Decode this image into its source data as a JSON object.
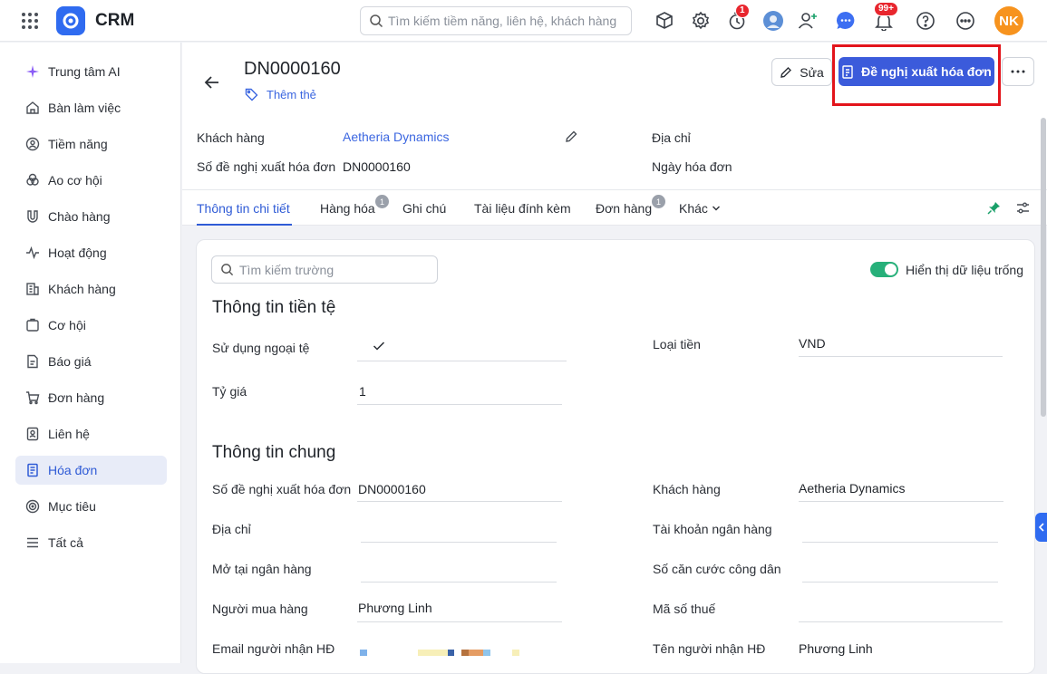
{
  "app": {
    "name": "CRM",
    "search_placeholder": "Tìm kiếm tiềm năng, liên hệ, khách hàng",
    "user_initials": "NK",
    "reminder_count": "1",
    "notification_count": "99+"
  },
  "sidebar": {
    "items": [
      {
        "label": "Trung tâm AI",
        "icon": "ai-sparkle-icon"
      },
      {
        "label": "Bàn làm việc",
        "icon": "home-icon"
      },
      {
        "label": "Tiềm năng",
        "icon": "lead-icon"
      },
      {
        "label": "Ao cơ hội",
        "icon": "pool-icon"
      },
      {
        "label": "Chào hàng",
        "icon": "magnet-icon"
      },
      {
        "label": "Hoạt động",
        "icon": "activity-icon"
      },
      {
        "label": "Khách hàng",
        "icon": "building-icon"
      },
      {
        "label": "Cơ hội",
        "icon": "opportunity-icon"
      },
      {
        "label": "Báo giá",
        "icon": "quote-icon"
      },
      {
        "label": "Đơn hàng",
        "icon": "cart-icon"
      },
      {
        "label": "Liên hệ",
        "icon": "contact-icon"
      },
      {
        "label": "Hóa đơn",
        "icon": "invoice-icon"
      },
      {
        "label": "Mục tiêu",
        "icon": "target-icon"
      },
      {
        "label": "Tất cả",
        "icon": "list-icon"
      }
    ],
    "active": "Hóa đơn"
  },
  "record": {
    "id": "DN0000160",
    "add_tag": "Thêm thẻ",
    "edit_label": "Sửa",
    "primary_action": "Đề nghị xuất hóa đơn",
    "header_fields": {
      "customer_label": "Khách hàng",
      "customer_value": "Aetheria Dynamics",
      "request_no_label": "Số đề nghị xuất hóa đơn",
      "request_no_value": "DN0000160",
      "address_label": "Địa chỉ",
      "invoice_date_label": "Ngày hóa đơn"
    }
  },
  "tabs": [
    {
      "label": "Thông tin chi tiết"
    },
    {
      "label": "Hàng hóa",
      "badge": "1"
    },
    {
      "label": "Ghi chú"
    },
    {
      "label": "Tài liệu đính kèm"
    },
    {
      "label": "Đơn hàng",
      "badge": "1"
    },
    {
      "label": "Khác"
    }
  ],
  "detail": {
    "field_search_placeholder": "Tìm kiếm trường",
    "show_empty_label": "Hiển thị dữ liệu trống",
    "currency_section": {
      "title": "Thông tin tiền tệ",
      "use_foreign_label": "Sử dụng ngoại tệ",
      "currency_label": "Loại tiền",
      "currency_value": "VND",
      "rate_label": "Tỷ giá",
      "rate_value": "1"
    },
    "general_section": {
      "title": "Thông tin chung",
      "request_no_label": "Số đề nghị xuất hóa đơn",
      "request_no_value": "DN0000160",
      "customer_label": "Khách hàng",
      "customer_value": "Aetheria Dynamics",
      "address_label": "Địa chỉ",
      "bank_account_label": "Tài khoản ngân hàng",
      "bank_open_label": "Mở tại ngân hàng",
      "citizen_id_label": "Số căn cước công dân",
      "buyer_label": "Người mua hàng",
      "buyer_value": "Phương Linh",
      "tax_code_label": "Mã số thuế",
      "email_label": "Email người nhận HĐ",
      "receiver_label": "Tên người nhận HĐ",
      "receiver_value": "Phương Linh"
    }
  }
}
